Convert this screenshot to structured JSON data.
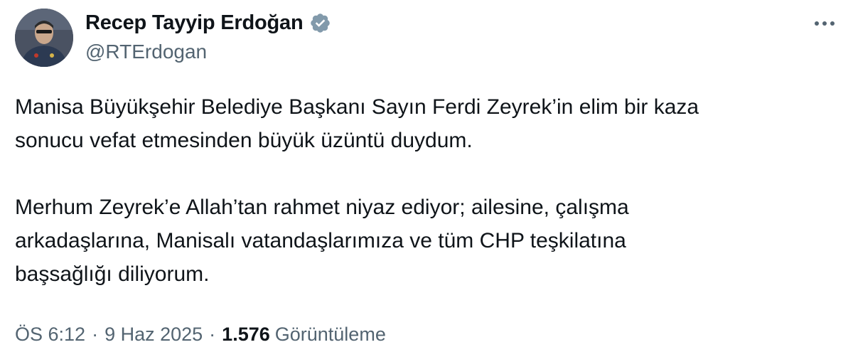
{
  "author": {
    "display_name": "Recep Tayyip Erdoğan",
    "handle": "@RTErdogan",
    "verified": true,
    "verified_badge_color": "#829aab"
  },
  "tweet": {
    "paragraph_1": "Manisa Büyükşehir Belediye Başkanı Sayın Ferdi Zeyrek’in elim bir kaza\nsonucu vefat etmesinden büyük üzüntü duydum.",
    "paragraph_2": "Merhum Zeyrek’e Allah’tan rahmet niyaz ediyor; ailesine, çalışma\narkadaşlarına, Manisalı vatandaşlarımıza ve tüm CHP teşkilatına\nbaşsağlığı diliyorum."
  },
  "meta": {
    "time": "ÖS 6:12",
    "separator": "·",
    "date": "9 Haz 2025",
    "views_count": "1.576",
    "views_label": "Görüntüleme"
  },
  "colors": {
    "text_primary": "#0f1419",
    "text_secondary": "#536471",
    "background": "#ffffff"
  },
  "icons": {
    "more": "more-horizontal-icon",
    "verified": "verified-badge-icon"
  }
}
